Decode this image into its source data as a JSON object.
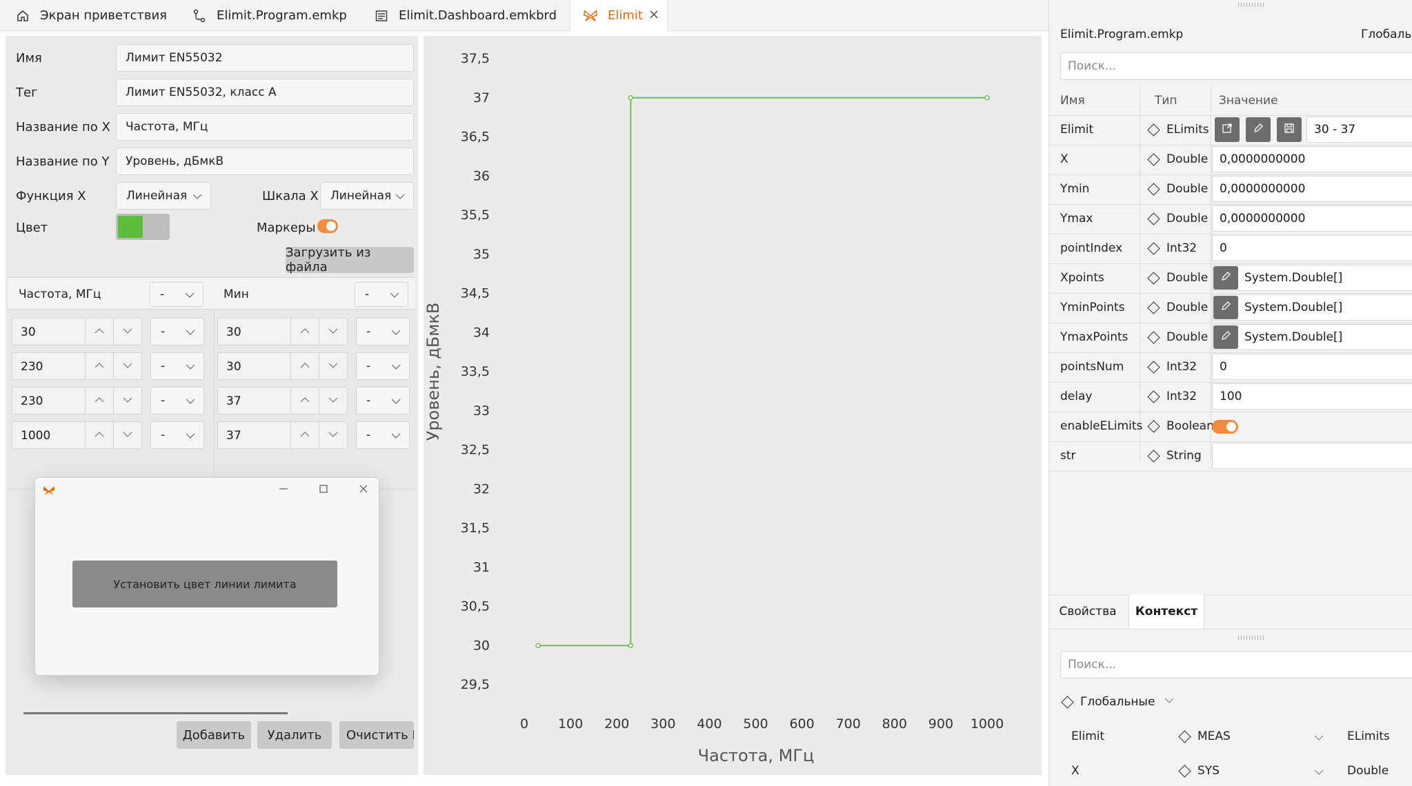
{
  "tabs": [
    {
      "label": "Экран приветствия",
      "icon": "home-icon"
    },
    {
      "label": "Elimit.Program.emkp",
      "icon": "flow-icon"
    },
    {
      "label": "Elimit.Dashboard.emkbrd",
      "icon": "dashboard-icon"
    },
    {
      "label": "Elimit",
      "icon": "butterfly-icon",
      "active": true,
      "close_icon": "close-icon"
    }
  ],
  "editor": {
    "name_label": "Имя",
    "name_value": "Лимит EN55032",
    "tag_label": "Тег",
    "tag_value": "Лимит EN55032, класс А",
    "xname_label": "Название по X",
    "xname_value": "Частота, МГц",
    "yname_label": "Название по Y",
    "yname_value": "Уровень, дБмкВ",
    "funcx_label": "Функция X",
    "funcx_value": "Линейная",
    "scalex_label": "Шкала X",
    "scalex_value": "Линейная",
    "color_label": "Цвет",
    "color_value": "#5bbd3a",
    "markers_label": "Маркеры",
    "markers_on": true,
    "load_button": "Загрузить из файла",
    "col1_header": "Частота, МГц",
    "col1_select": "-",
    "col2_header": "Мин",
    "col2_select": "-",
    "rows": [
      {
        "x": "30",
        "xs": "-",
        "y": "30",
        "ys": "-"
      },
      {
        "x": "230",
        "xs": "-",
        "y": "30",
        "ys": "-"
      },
      {
        "x": "230",
        "xs": "-",
        "y": "37",
        "ys": "-"
      },
      {
        "x": "1000",
        "xs": "-",
        "y": "37",
        "ys": "-"
      }
    ],
    "add_button": "Добавить",
    "delete_button": "Удалить",
    "clear_button": "Очистить E"
  },
  "dialog": {
    "icon": "butterfly-icon",
    "button": "Установить цвет линии лимита"
  },
  "chart_data": {
    "type": "line",
    "xlabel": "Частота, МГц",
    "ylabel": "Уровень, дБмкВ",
    "xlim": [
      0,
      1000
    ],
    "ylim": [
      29.5,
      37.5
    ],
    "xticks": [
      "0",
      "100",
      "200",
      "300",
      "400",
      "500",
      "600",
      "700",
      "800",
      "900",
      "1000"
    ],
    "yticks": [
      "37,5",
      "37",
      "36,5",
      "36",
      "35,5",
      "35",
      "34,5",
      "34",
      "33,5",
      "33",
      "32,5",
      "32",
      "31,5",
      "31",
      "30,5",
      "30",
      "29,5"
    ],
    "x": [
      30,
      230,
      230,
      1000
    ],
    "y": [
      30,
      30,
      37,
      37
    ],
    "color": "#6dbf4a",
    "markers": true
  },
  "props": {
    "file": "Elimit.Program.emkp",
    "scope": "Глобальн",
    "search_placeholder": "Поиск...",
    "col_name": "Имя",
    "col_type": "Тип",
    "col_value": "Значение",
    "rows": [
      {
        "name": "Elimit",
        "type": "ELimits",
        "value": "30 - 37",
        "kind": "elimit"
      },
      {
        "name": "X",
        "type": "Double",
        "value": "0,0000000000",
        "kind": "text"
      },
      {
        "name": "Ymin",
        "type": "Double",
        "value": "0,0000000000",
        "kind": "text"
      },
      {
        "name": "Ymax",
        "type": "Double",
        "value": "0,0000000000",
        "kind": "text"
      },
      {
        "name": "pointIndex",
        "type": "Int32",
        "value": "0",
        "kind": "text"
      },
      {
        "name": "Xpoints",
        "type": "Double",
        "value": "System.Double[]",
        "kind": "pen"
      },
      {
        "name": "YminPoints",
        "type": "Double",
        "value": "System.Double[]",
        "kind": "pen"
      },
      {
        "name": "YmaxPoints",
        "type": "Double",
        "value": "System.Double[]",
        "kind": "pen"
      },
      {
        "name": "pointsNum",
        "type": "Int32",
        "value": "0",
        "kind": "text"
      },
      {
        "name": "delay",
        "type": "Int32",
        "value": "100",
        "kind": "text"
      },
      {
        "name": "enableELimits",
        "type": "Boolean",
        "value": "",
        "kind": "toggle"
      },
      {
        "name": "str",
        "type": "String",
        "value": "",
        "kind": "text"
      }
    ],
    "tab_properties": "Свойства",
    "tab_context": "Контекст",
    "context_search_placeholder": "Поиск...",
    "context_scope": "Глобальные",
    "context_rows": [
      {
        "name": "Elimit",
        "scope": "MEAS",
        "type": "ELimits"
      },
      {
        "name": "X",
        "scope": "SYS",
        "type": "Double"
      }
    ]
  }
}
